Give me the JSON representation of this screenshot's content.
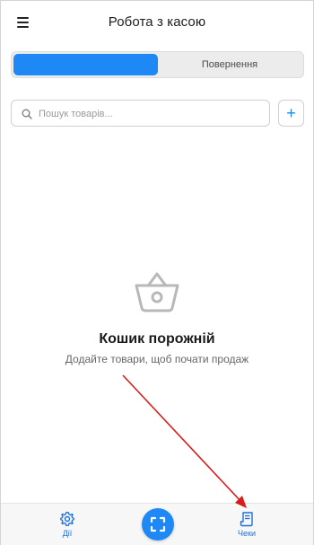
{
  "header": {
    "title": "Робота з касою"
  },
  "tabs": {
    "active_label": "",
    "inactive_label": "Повернення"
  },
  "search": {
    "placeholder": "Пошук товарів..."
  },
  "add_button": {
    "label": "+"
  },
  "empty_state": {
    "title": "Кошик порожній",
    "subtitle": "Додайте товари, щоб почати продаж",
    "icon": "basket-icon"
  },
  "bottom_nav": {
    "actions_label": "Дії",
    "receipts_label": "Чеки",
    "actions_icon": "gear-icon",
    "receipts_icon": "receipt-icon",
    "scan_icon": "scan-icon"
  },
  "colors": {
    "accent": "#1e88f5",
    "arrow": "#d81c1c"
  }
}
